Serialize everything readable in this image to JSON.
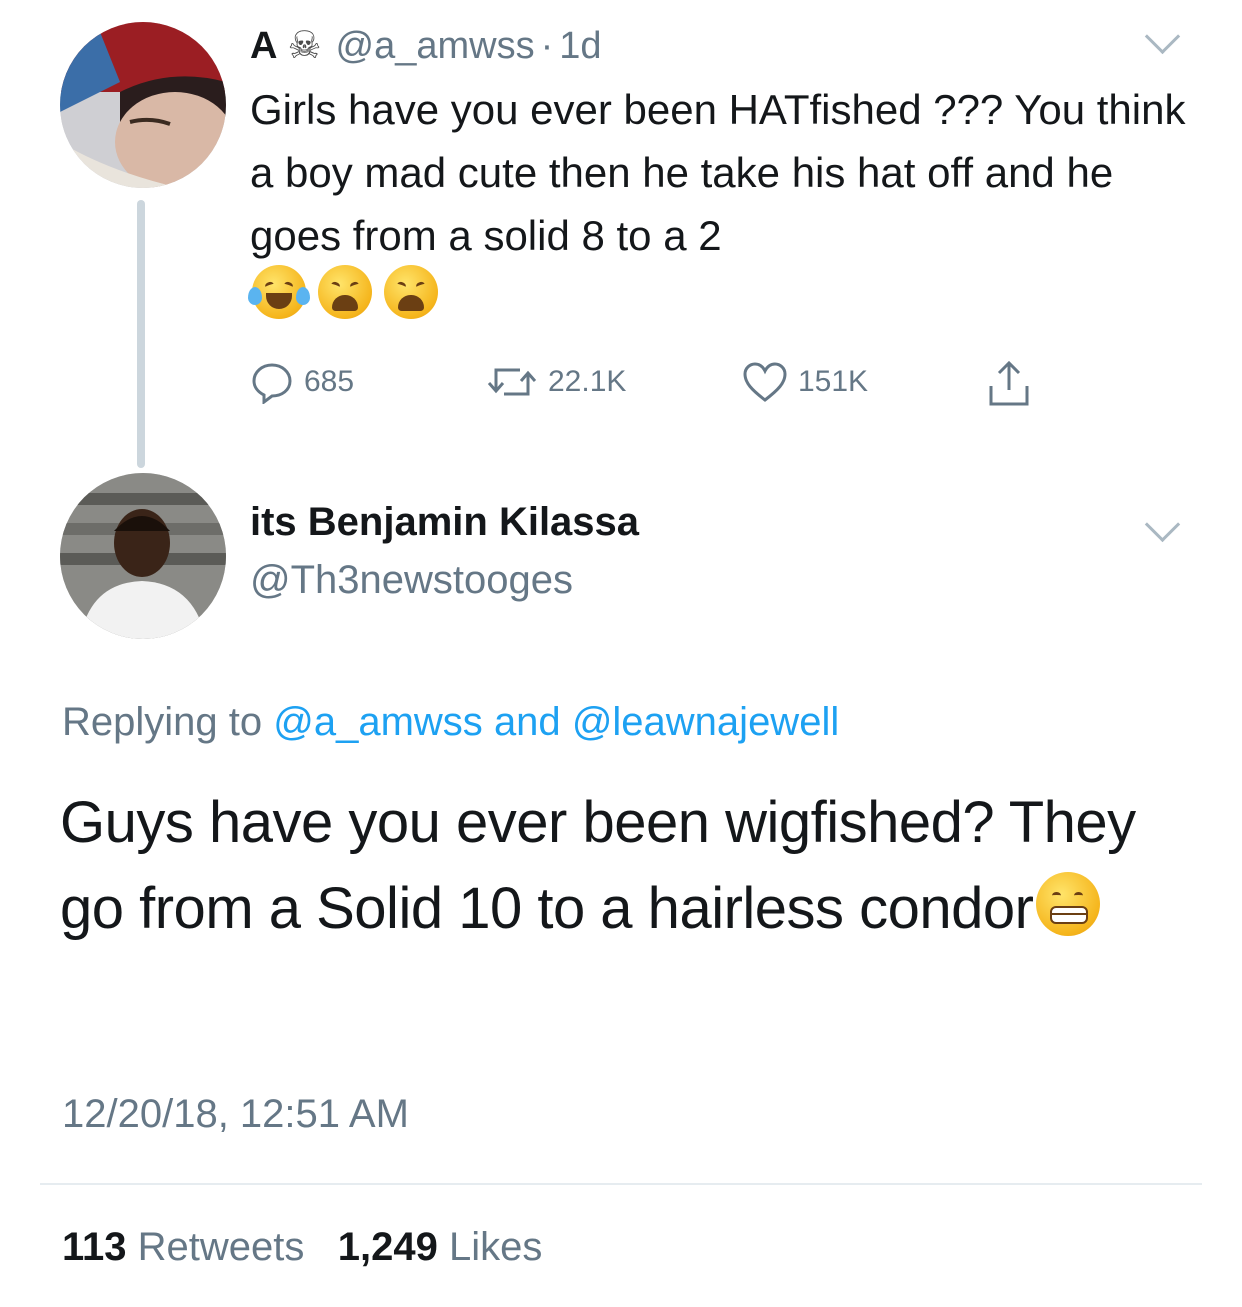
{
  "parent_tweet": {
    "display_name": "A",
    "name_badge_icon": "skull-crossbones-icon",
    "handle": "@a_amwss",
    "separator": "·",
    "age": "1d",
    "text": "Girls have you ever been HATfished ??? You think a boy mad cute then he take his hat off and he goes from a solid 8 to a 2",
    "emojis": [
      "face-with-tears-of-joy-icon",
      "weary-face-icon",
      "weary-face-icon"
    ],
    "actions": {
      "replies": "685",
      "retweets": "22.1K",
      "likes": "151K"
    }
  },
  "reply_tweet": {
    "display_name": "its Benjamin Kilassa",
    "handle": "@Th3newstooges",
    "replying_prefix": "Replying to",
    "replying_mention_1": "@a_amwss",
    "replying_and": "and",
    "replying_mention_2": "@leawnajewell",
    "text": "Guys have you ever been wigfished? They go from a Solid 10 to a hairless condor",
    "trailing_emoji": "grimacing-face-icon",
    "timestamp": "12/20/18, 12:51 AM",
    "stats": {
      "retweets_count": "113",
      "retweets_label": "Retweets",
      "likes_count": "1,249",
      "likes_label": "Likes"
    }
  },
  "colors": {
    "text": "#14171a",
    "secondary": "#657786",
    "link": "#1da1f2",
    "divider": "#e6ecf0",
    "thread_line": "#ccd6dd"
  }
}
